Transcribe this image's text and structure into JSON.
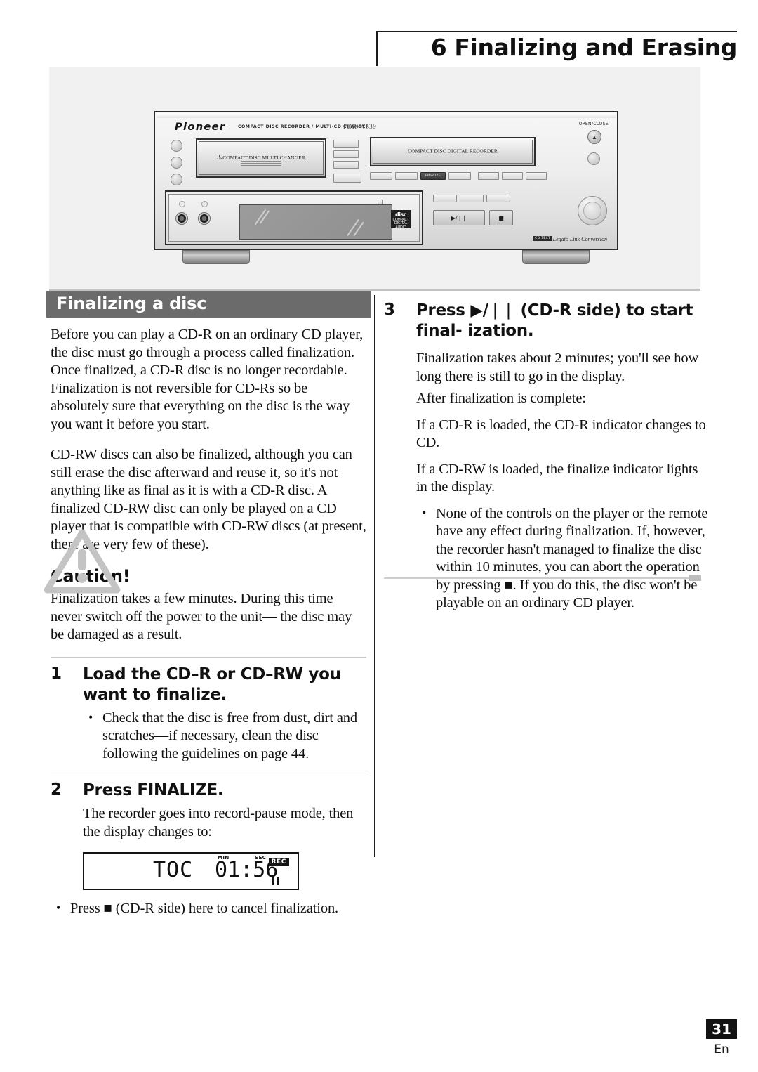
{
  "header": {
    "chapter_title": "6 Finalizing and Erasing"
  },
  "product_image": {
    "brand": "Pioneer",
    "brand_subtitle": "COMPACT DISC RECORDER / MULTI-CD CHANGER",
    "model": "PDR-W839",
    "changer_tray_label_number": "3",
    "changer_tray_label_text": "-COMPACT DISC MULTI CHANGER",
    "recorder_tray_label": "COMPACT DISC DIGITAL RECORDER",
    "open_close_label": "OPEN/CLOSE",
    "finalize_button_label": "FINALIZE",
    "play_pause_button_label": "▶/❘❘",
    "stop_button_label": "■",
    "cd_text_badge": "CD TEXT",
    "legato_text": "Legato Link Conversion",
    "disc_logo_text": "COMPACT DIGITAL AUDIO"
  },
  "left_column": {
    "section_heading": "Finalizing a disc",
    "paragraph_1": "Before you can play a CD-R on an ordinary CD player, the disc must go through a process called finalization. Once finalized, a CD-R disc is no longer recordable. Finalization is not reversible for CD-Rs so be absolutely sure that everything on the disc is the way you want it before you start.",
    "paragraph_2": "CD-RW discs can also be finalized, although you can still erase the disc afterward and reuse it, so it's not anything like as final as it is with a CD-R disc. A finalized CD-RW disc can only be played on a CD player that is compatible with CD-RW discs (at present, there are very few of these).",
    "caution_heading": "Caution!",
    "caution_text": "Finalization takes a few minutes. During this time never switch off the power to the unit— the disc may be damaged as a result.",
    "step1": {
      "number": "1",
      "title": "Load the CD–R or CD–RW you want to finalize.",
      "bullets": [
        "Check that the disc is free from dust, dirt and scratches—if necessary, clean the disc following the guidelines on page 44."
      ]
    },
    "step2": {
      "number": "2",
      "title": "Press FINALIZE.",
      "body": "The recorder goes into record-pause mode, then the display changes to:",
      "bullet": "Press ■ (CD-R side) here to cancel finalization."
    },
    "display_figure": {
      "mode": "TOC",
      "time": "01:56",
      "min_label": "MIN",
      "sec_label": "SEC",
      "rec_indicator": "REC",
      "pause_indicator": "❘❘"
    }
  },
  "right_column": {
    "step3": {
      "number": "3",
      "title": "Press ▶/❘❘ (CD-R side) to start final- ization.",
      "body_1": "Finalization takes about 2 minutes; you'll see how long there is still to go in the display.",
      "body_2": "After finalization is complete:",
      "body_3": "If a CD-R is loaded, the CD-R indicator changes to CD.",
      "body_4": "If a CD-RW is loaded, the finalize indicator lights in the display.",
      "bullets": [
        "None of the controls on the player or the remote have any effect during finalization. If, however, the recorder hasn't managed to finalize the disc within 10 minutes, you can abort the operation by pressing ■. If you do this, the disc won't be playable on an ordinary CD player."
      ]
    }
  },
  "footer": {
    "page_number": "31",
    "language": "En"
  },
  "colors": {
    "section_bar": "#6b6b6b",
    "page_number_bg": "#121212",
    "photo_panel_bg": "#f1f1f1",
    "text": "#101010"
  }
}
